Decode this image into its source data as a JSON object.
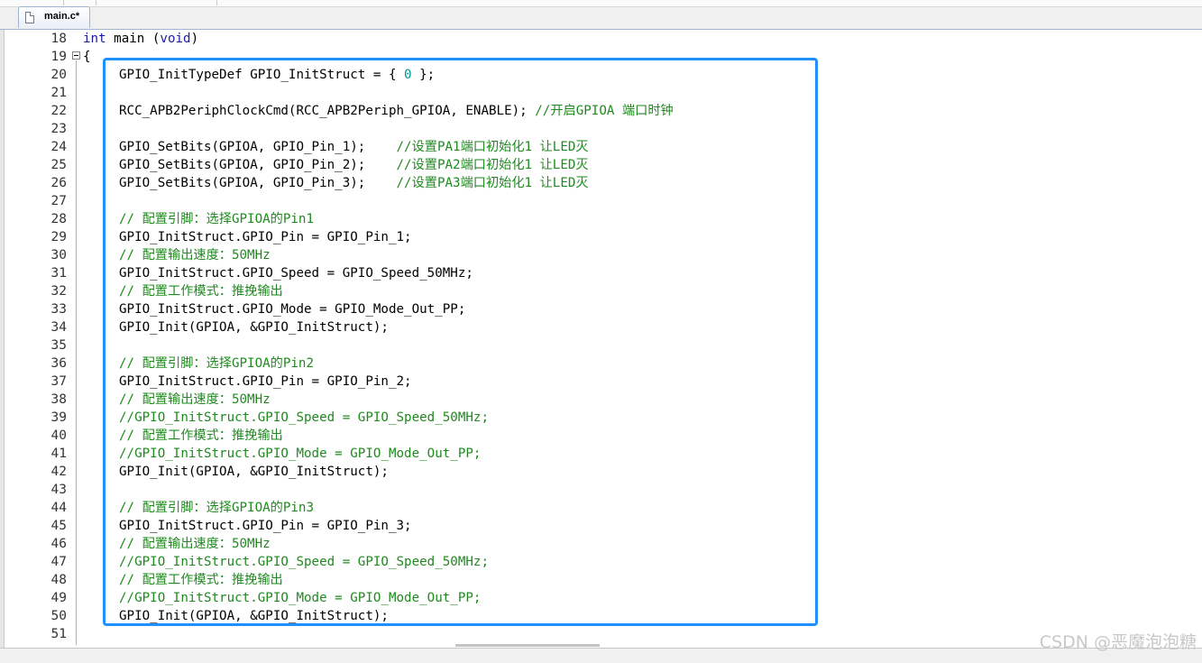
{
  "tab": {
    "label": "main.c*",
    "icon": "file-icon"
  },
  "lines": [
    {
      "n": "18",
      "indent": false,
      "parts": [
        {
          "t": "kw",
          "v": "int"
        },
        {
          "t": "tx",
          "v": " main ("
        },
        {
          "t": "kw",
          "v": "void"
        },
        {
          "t": "tx",
          "v": ")"
        }
      ]
    },
    {
      "n": "19",
      "indent": false,
      "parts": [
        {
          "t": "tx",
          "v": "{"
        }
      ]
    },
    {
      "n": "20",
      "indent": true,
      "parts": [
        {
          "t": "tx",
          "v": "GPIO_InitTypeDef GPIO_InitStruct = { "
        },
        {
          "t": "num",
          "v": "0"
        },
        {
          "t": "tx",
          "v": " };"
        }
      ]
    },
    {
      "n": "21",
      "indent": true,
      "parts": []
    },
    {
      "n": "22",
      "indent": true,
      "parts": [
        {
          "t": "tx",
          "v": "RCC_APB2PeriphClockCmd(RCC_APB2Periph_GPIOA, ENABLE); "
        },
        {
          "t": "cm",
          "v": "//开启GPIOA 端口时钟"
        }
      ]
    },
    {
      "n": "23",
      "indent": true,
      "parts": []
    },
    {
      "n": "24",
      "indent": true,
      "parts": [
        {
          "t": "tx",
          "v": "GPIO_SetBits(GPIOA, GPIO_Pin_1);    "
        },
        {
          "t": "cm",
          "v": "//设置PA1端口初始化1 让LED灭"
        }
      ]
    },
    {
      "n": "25",
      "indent": true,
      "parts": [
        {
          "t": "tx",
          "v": "GPIO_SetBits(GPIOA, GPIO_Pin_2);    "
        },
        {
          "t": "cm",
          "v": "//设置PA2端口初始化1 让LED灭"
        }
      ]
    },
    {
      "n": "26",
      "indent": true,
      "parts": [
        {
          "t": "tx",
          "v": "GPIO_SetBits(GPIOA, GPIO_Pin_3);    "
        },
        {
          "t": "cm",
          "v": "//设置PA3端口初始化1 让LED灭"
        }
      ]
    },
    {
      "n": "27",
      "indent": true,
      "parts": []
    },
    {
      "n": "28",
      "indent": true,
      "parts": [
        {
          "t": "cm",
          "v": "// 配置引脚：选择GPIOA的Pin1"
        }
      ]
    },
    {
      "n": "29",
      "indent": true,
      "parts": [
        {
          "t": "tx",
          "v": "GPIO_InitStruct.GPIO_Pin = GPIO_Pin_1;"
        }
      ]
    },
    {
      "n": "30",
      "indent": true,
      "parts": [
        {
          "t": "cm",
          "v": "// 配置输出速度：50MHz"
        }
      ]
    },
    {
      "n": "31",
      "indent": true,
      "parts": [
        {
          "t": "tx",
          "v": "GPIO_InitStruct.GPIO_Speed = GPIO_Speed_50MHz;"
        }
      ]
    },
    {
      "n": "32",
      "indent": true,
      "parts": [
        {
          "t": "cm",
          "v": "// 配置工作模式：推挽输出"
        }
      ]
    },
    {
      "n": "33",
      "indent": true,
      "parts": [
        {
          "t": "tx",
          "v": "GPIO_InitStruct.GPIO_Mode = GPIO_Mode_Out_PP;"
        }
      ]
    },
    {
      "n": "34",
      "indent": true,
      "parts": [
        {
          "t": "tx",
          "v": "GPIO_Init(GPIOA, &GPIO_InitStruct);"
        }
      ]
    },
    {
      "n": "35",
      "indent": true,
      "parts": []
    },
    {
      "n": "36",
      "indent": true,
      "parts": [
        {
          "t": "cm",
          "v": "// 配置引脚：选择GPIOA的Pin2"
        }
      ]
    },
    {
      "n": "37",
      "indent": true,
      "parts": [
        {
          "t": "tx",
          "v": "GPIO_InitStruct.GPIO_Pin = GPIO_Pin_2;"
        }
      ]
    },
    {
      "n": "38",
      "indent": true,
      "parts": [
        {
          "t": "cm",
          "v": "// 配置输出速度：50MHz"
        }
      ]
    },
    {
      "n": "39",
      "indent": true,
      "parts": [
        {
          "t": "cm",
          "v": "//GPIO_InitStruct.GPIO_Speed = GPIO_Speed_50MHz;"
        }
      ]
    },
    {
      "n": "40",
      "indent": true,
      "parts": [
        {
          "t": "cm",
          "v": "// 配置工作模式：推挽输出"
        }
      ]
    },
    {
      "n": "41",
      "indent": true,
      "parts": [
        {
          "t": "cm",
          "v": "//GPIO_InitStruct.GPIO_Mode = GPIO_Mode_Out_PP;"
        }
      ]
    },
    {
      "n": "42",
      "indent": true,
      "parts": [
        {
          "t": "tx",
          "v": "GPIO_Init(GPIOA, &GPIO_InitStruct);"
        }
      ]
    },
    {
      "n": "43",
      "indent": true,
      "parts": []
    },
    {
      "n": "44",
      "indent": true,
      "parts": [
        {
          "t": "cm",
          "v": "// 配置引脚：选择GPIOA的Pin3"
        }
      ]
    },
    {
      "n": "45",
      "indent": true,
      "parts": [
        {
          "t": "tx",
          "v": "GPIO_InitStruct.GPIO_Pin = GPIO_Pin_3;"
        }
      ]
    },
    {
      "n": "46",
      "indent": true,
      "parts": [
        {
          "t": "cm",
          "v": "// 配置输出速度：50MHz"
        }
      ]
    },
    {
      "n": "47",
      "indent": true,
      "parts": [
        {
          "t": "cm",
          "v": "//GPIO_InitStruct.GPIO_Speed = GPIO_Speed_50MHz;"
        }
      ]
    },
    {
      "n": "48",
      "indent": true,
      "parts": [
        {
          "t": "cm",
          "v": "// 配置工作模式：推挽输出"
        }
      ]
    },
    {
      "n": "49",
      "indent": true,
      "parts": [
        {
          "t": "cm",
          "v": "//GPIO_InitStruct.GPIO_Mode = GPIO_Mode_Out_PP;"
        }
      ]
    },
    {
      "n": "50",
      "indent": true,
      "parts": [
        {
          "t": "tx",
          "v": "GPIO_Init(GPIOA, &GPIO_InitStruct);"
        }
      ]
    },
    {
      "n": "51",
      "indent": false,
      "parts": []
    }
  ],
  "watermark": "CSDN @恶魔泡泡糖",
  "colors": {
    "keyword": "#1a1aa6",
    "number": "#009999",
    "comment": "#1f8a1f",
    "highlight": "#1e90ff"
  }
}
